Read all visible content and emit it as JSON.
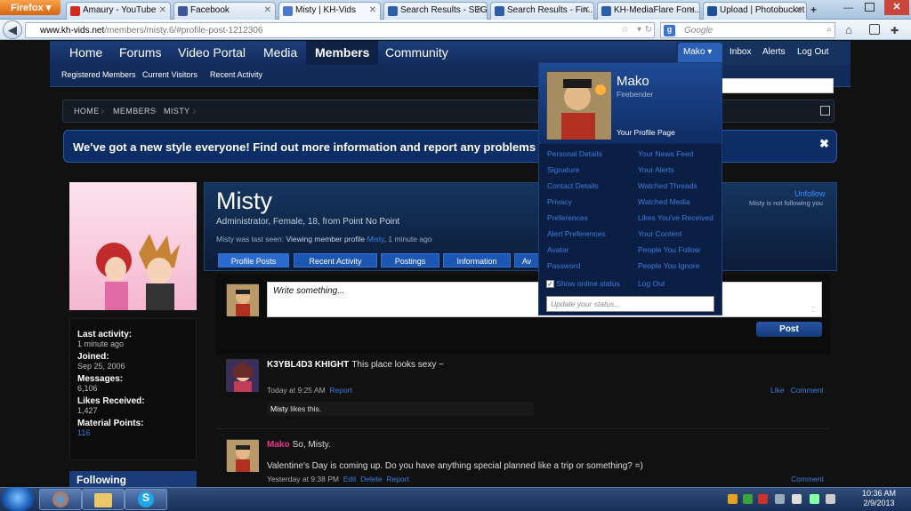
{
  "browser": {
    "menu_label": "Firefox",
    "tabs": [
      {
        "label": "Amaury - YouTube",
        "icon": "youtube-icon",
        "color": "#d3281e"
      },
      {
        "label": "Facebook",
        "icon": "facebook-icon",
        "color": "#3b5998"
      },
      {
        "label": "Misty | KH-Vids",
        "icon": "khvids-icon",
        "color": "#4a79c9"
      },
      {
        "label": "Search Results - SEG...",
        "icon": "khvids-icon",
        "color": "#2f5ea8"
      },
      {
        "label": "Search Results - Fin...",
        "icon": "khvids-icon",
        "color": "#2f5ea8"
      },
      {
        "label": "KH-MediaFlare Foru...",
        "icon": "khvids-icon",
        "color": "#2f5ea8"
      },
      {
        "label": "Upload | Photobucket",
        "icon": "photobucket-icon",
        "color": "#1a4f9a"
      }
    ],
    "new_tab": "+",
    "url_domain": "www.kh-vids.net",
    "url_path": "/members/misty.6/#profile-post-1212306",
    "search_placeholder": "Google",
    "search_engine_badge": "g"
  },
  "site": {
    "nav": [
      "Home",
      "Forums",
      "Video Portal",
      "Media",
      "Members",
      "Community"
    ],
    "subnav": [
      "Registered Members",
      "Current Visitors",
      "Recent Activity"
    ],
    "user_nav": {
      "user": "Mako",
      "inbox": "Inbox",
      "alerts": "Alerts",
      "logout": "Log Out"
    },
    "breadcrumbs": [
      "Home",
      "Members",
      "Misty"
    ],
    "notice": "We've got a new style everyone! Find out more information and report any problems you m",
    "close_symbol": "✖"
  },
  "profile": {
    "name": "Misty",
    "info_prefix": "Administrator, Female, 18, from",
    "location": "Point No Point",
    "last_seen_prefix": "Misty was last seen:",
    "last_seen_activity": "Viewing member profile",
    "last_seen_member": "Misty",
    "last_seen_time": ", 1 minute ago",
    "unfollow": "Unfollow",
    "not_following": "Misty is not following you",
    "tabs": [
      "Profile Posts",
      "Recent Activity",
      "Postings",
      "Information",
      "Av"
    ],
    "stats": [
      {
        "label": "Last activity:",
        "value": "1 minute ago"
      },
      {
        "label": "Joined:",
        "value": "Sep 25, 2006"
      },
      {
        "label": "Messages:",
        "value": "6,106"
      },
      {
        "label": "Likes Received:",
        "value": "1,427"
      },
      {
        "label": "Material Points:",
        "value": "116"
      }
    ],
    "following_label": "Following"
  },
  "posts": {
    "placeholder": "Write something...",
    "post_button": "Post",
    "items": [
      {
        "author": "K3YBL4D3 KHIGHT",
        "text": "This place looks sexy ~",
        "time": "Today at 9:25 AM",
        "actions": [
          "Report"
        ],
        "right_actions": [
          "Like",
          "Comment"
        ],
        "likes": "likes this.",
        "liker": "Misty"
      },
      {
        "author": "Mako",
        "text": "So, Misty.",
        "body": "Valentine's Day is coming up. Do you have anything special planned like a trip or something? =)",
        "time": "Yesterday at 9:38 PM",
        "actions": [
          "Edit",
          "Delete",
          "Report"
        ],
        "right_actions": [
          "Comment"
        ]
      }
    ]
  },
  "popup": {
    "name": "Mako",
    "title": "Firebender",
    "profile_link": "Your Profile Page",
    "left_links": [
      "Personal Details",
      "Signature",
      "Contact Details",
      "Privacy",
      "Preferences",
      "Alert Preferences",
      "Avatar",
      "Password"
    ],
    "right_links": [
      "Your News Feed",
      "Your Alerts",
      "Watched Threads",
      "Watched Media",
      "Likes You've Received",
      "Your Content",
      "People You Follow",
      "People You Ignore"
    ],
    "show_online": "Show online status",
    "log_out": "Log Out",
    "status_placeholder": "Update your status..."
  },
  "taskbar": {
    "time": "10:36 AM",
    "date": "2/9/2013"
  },
  "colors": {
    "accent": "#1c57b4",
    "link": "#3b7de2",
    "mako_name": "#e8368f",
    "notice_bg": "#0c2d66"
  }
}
